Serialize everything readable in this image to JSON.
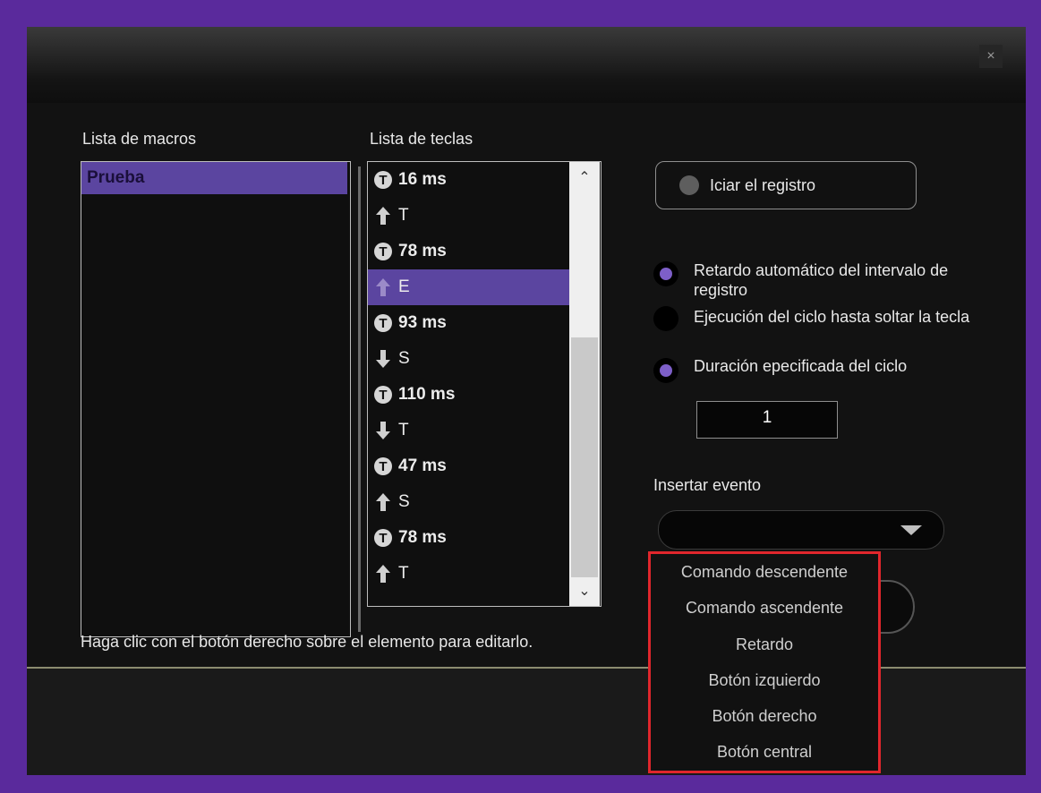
{
  "window": {
    "close_label": "×"
  },
  "macros": {
    "heading": "Lista de macros",
    "items": [
      "Prueba"
    ]
  },
  "keys": {
    "heading": "Lista de teclas",
    "items": [
      {
        "type": "delay",
        "label": "16 ms"
      },
      {
        "type": "up",
        "label": "T"
      },
      {
        "type": "delay",
        "label": "78 ms"
      },
      {
        "type": "up",
        "label": "E",
        "selected": true
      },
      {
        "type": "delay",
        "label": "93 ms"
      },
      {
        "type": "down",
        "label": "S"
      },
      {
        "type": "delay",
        "label": "110 ms"
      },
      {
        "type": "down",
        "label": "T"
      },
      {
        "type": "delay",
        "label": "47 ms"
      },
      {
        "type": "up",
        "label": "S"
      },
      {
        "type": "delay",
        "label": "78 ms"
      },
      {
        "type": "up",
        "label": "T"
      }
    ]
  },
  "record_button": "Iciar el registro",
  "options": {
    "auto_delay_line1": "Retardo automático del intervalo de",
    "auto_delay_line2": "registro",
    "loop_until_release": "Ejecución del ciclo hasta soltar la tecla",
    "specified_duration": "Duración epecificada del ciclo",
    "duration_value": "1"
  },
  "insert_event": {
    "label": "Insertar evento",
    "options": [
      "Comando descendente",
      "Comando ascendente",
      "Retardo",
      "Botón izquierdo",
      "Botón derecho",
      "Botón central"
    ]
  },
  "hint": "Haga clic con el botón derecho sobre el elemento para editarlo.",
  "colors": {
    "accent": "#5b45a0",
    "highlight_border": "#e0262c",
    "radio_dot": "#7d5fc8"
  }
}
